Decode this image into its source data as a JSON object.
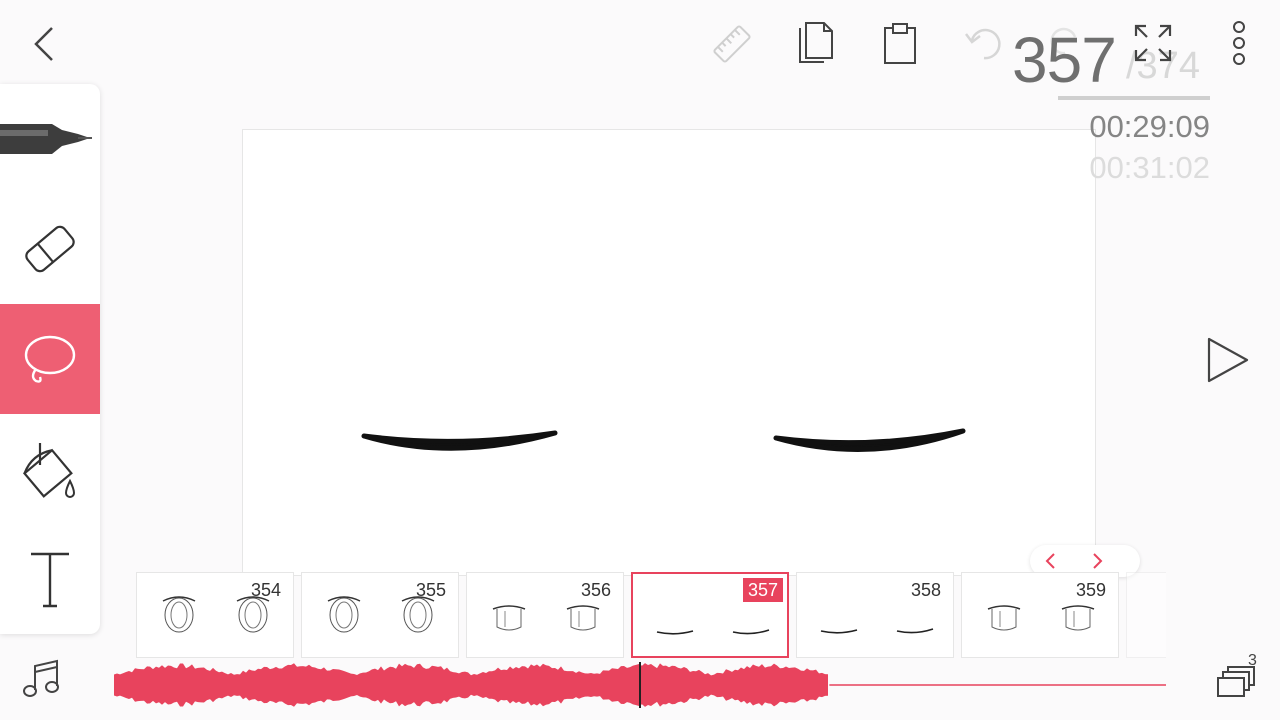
{
  "header": {
    "current_frame": "357",
    "total_frames": "/374",
    "current_time": "00:29:09",
    "total_time": "00:31:02"
  },
  "tools": [
    {
      "name": "pen-tool",
      "active": false
    },
    {
      "name": "eraser-tool",
      "active": false
    },
    {
      "name": "lasso-tool",
      "active": true
    },
    {
      "name": "fill-tool",
      "active": false
    },
    {
      "name": "text-tool",
      "active": false
    }
  ],
  "frames": [
    {
      "number": "354",
      "drawing": "open-eyes"
    },
    {
      "number": "355",
      "drawing": "open-eyes"
    },
    {
      "number": "356",
      "drawing": "half-eyes"
    },
    {
      "number": "357",
      "drawing": "closed-eyes",
      "active": true
    },
    {
      "number": "358",
      "drawing": "closed-eyes"
    },
    {
      "number": "359",
      "drawing": "half-eyes"
    }
  ],
  "layers_count": "3",
  "colors": {
    "accent": "#e8435d",
    "active_tool": "#ee5f73",
    "background": "#fbfafb"
  },
  "audio": {
    "playhead_fraction": 0.5,
    "waveform_end_fraction": 0.68
  }
}
